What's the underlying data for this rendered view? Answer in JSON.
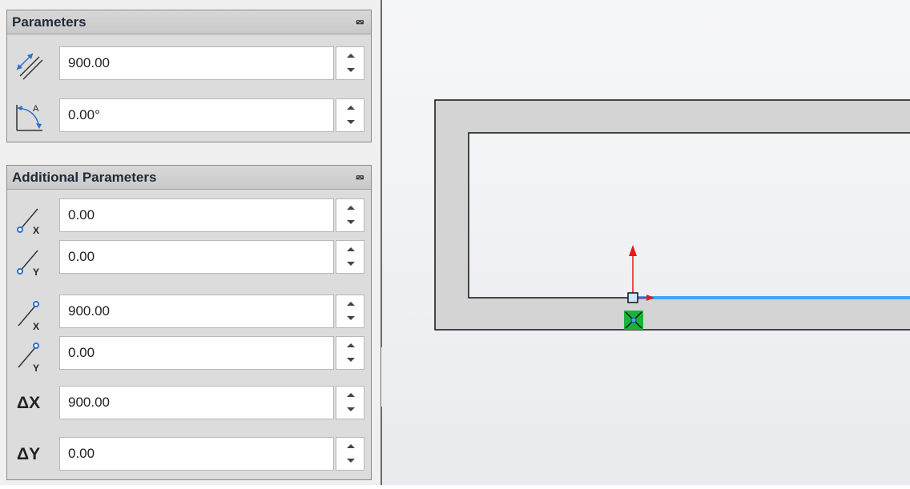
{
  "parameters": {
    "title": "Parameters",
    "length": "900.00",
    "angle": "0.00°"
  },
  "additional_parameters": {
    "title": "Additional Parameters",
    "start_x": "0.00",
    "start_y": "0.00",
    "end_x": "900.00",
    "end_y": "0.00",
    "delta_x_label": "ΔX",
    "delta_x": "900.00",
    "delta_y_label": "ΔY",
    "delta_y": "0.00"
  },
  "icons": {
    "collapse": "double-chevron-up-icon",
    "length": "length-dimension-icon",
    "angle": "angle-icon",
    "start_x": "start-point-x-icon",
    "start_y": "start-point-y-icon",
    "end_x": "end-point-x-icon",
    "end_y": "end-point-y-icon"
  },
  "colors": {
    "selected_line": "#4aa3f0",
    "axis_arrow": "#e8191a",
    "origin_marker": "#18b33c",
    "sketch_fill": "#d4d4d4"
  }
}
